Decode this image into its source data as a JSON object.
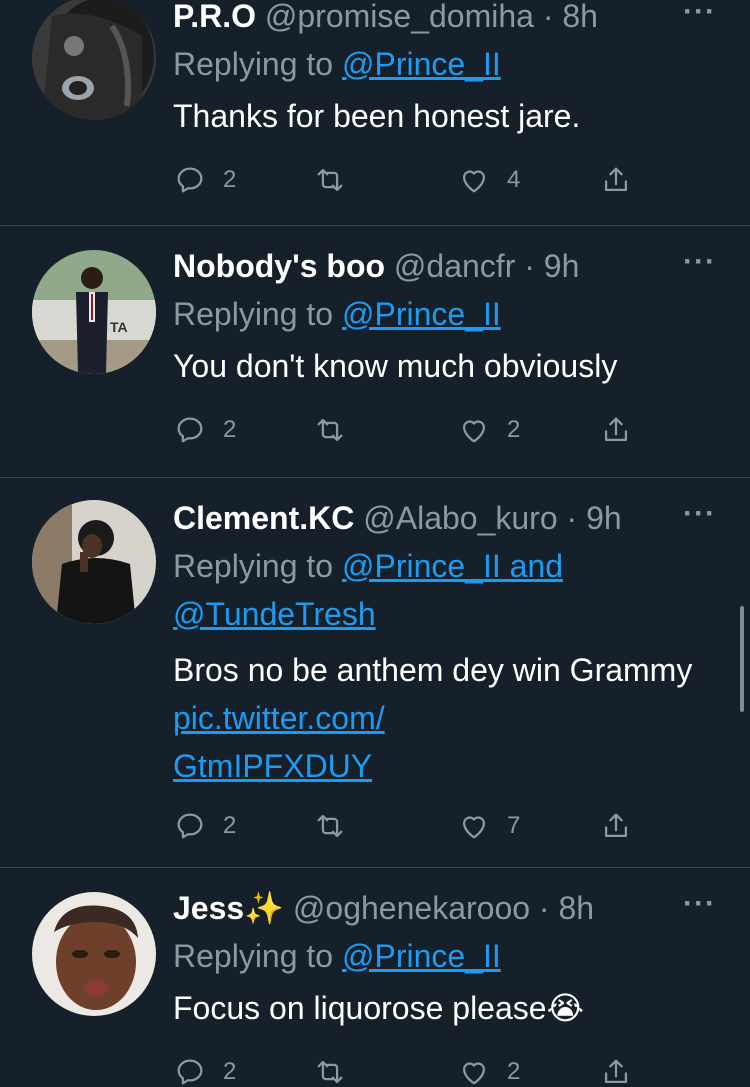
{
  "tweets": [
    {
      "name": "P.R.O",
      "handle": "@promise_domiha",
      "time": "8h",
      "replying_prefix": "Replying to",
      "replying_to": "@Prince_II",
      "text": "Thanks for been honest jare.",
      "replies": "2",
      "retweets": "",
      "likes": "4"
    },
    {
      "name": "Nobody's boo",
      "handle": "@dancfr",
      "time": "9h",
      "replying_prefix": "Replying to",
      "replying_to": "@Prince_II",
      "text": "You don't know much obviously",
      "replies": "2",
      "retweets": "",
      "likes": "2"
    },
    {
      "name": "Clement.KC",
      "handle": "@Alabo_kuro",
      "time": "9h",
      "replying_prefix": "Replying to",
      "replying_to": "@Prince_II and",
      "replying_to_2": "@TundeTresh",
      "text": "Bros no be anthem dey win Grammy",
      "link_line1": "pic.twitter.com/",
      "link_line2": "GtmIPFXDUY",
      "replies": "2",
      "retweets": "",
      "likes": "7"
    },
    {
      "name": "Jess",
      "name_emoji": "✨",
      "handle": "@oghenekarooo",
      "time": "8h",
      "replying_prefix": "Replying to",
      "replying_to": "@Prince_II",
      "text": "Focus on liquorose please",
      "text_emoji": "😭",
      "replies": "2",
      "retweets": "",
      "likes": "2"
    }
  ],
  "separator": "·",
  "more_icon": "···",
  "colors": {
    "background": "#15202b",
    "text": "#ffffff",
    "secondary": "#8b98a5",
    "link": "#1d9bf0",
    "divider": "#38444d"
  }
}
